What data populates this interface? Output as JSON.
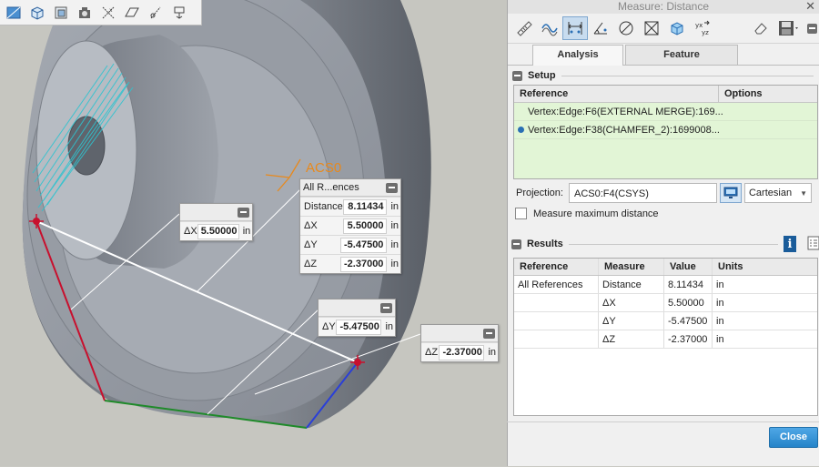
{
  "viewport": {
    "csys_label": "ACS0",
    "callout_main": {
      "title": "All R...ences",
      "rows": [
        {
          "label": "Distance",
          "value": "8.11434",
          "unit": "in"
        },
        {
          "label": "ΔX",
          "value": "5.50000",
          "unit": "in"
        },
        {
          "label": "ΔY",
          "value": "-5.47500",
          "unit": "in"
        },
        {
          "label": "ΔZ",
          "value": "-2.37000",
          "unit": "in"
        }
      ]
    },
    "callout_dx": {
      "label": "ΔX",
      "value": "5.50000",
      "unit": "in"
    },
    "callout_dy": {
      "label": "ΔY",
      "value": "-5.47500",
      "unit": "in"
    },
    "callout_dz": {
      "label": "ΔZ",
      "value": "-2.37000",
      "unit": "in"
    },
    "toolbar_icons": [
      "shade-icon",
      "view-cube-icon",
      "saved-views-icon",
      "camera-icon",
      "datum-display-icon",
      "plane-display-icon",
      "axis-display-icon",
      "spin-center-icon"
    ]
  },
  "panel": {
    "title": "Measure: Distance",
    "tabs": [
      "Analysis",
      "Feature"
    ],
    "setup": {
      "title": "Setup",
      "headers": [
        "Reference",
        "Options"
      ],
      "rows": [
        {
          "reference": "Vertex:Edge:F6(EXTERNAL MERGE):169...",
          "options": ""
        },
        {
          "reference": "Vertex:Edge:F38(CHAMFER_2):1699008...",
          "options": ""
        }
      ],
      "projection_label": "Projection:",
      "projection_value": "ACS0:F4(CSYS)",
      "coord_mode": "Cartesian",
      "max_distance_label": "Measure maximum distance"
    },
    "results": {
      "title": "Results",
      "headers": [
        "Reference",
        "Measure",
        "Value",
        "Units"
      ],
      "rows": [
        {
          "reference": "All References",
          "measure": "Distance",
          "value": "8.11434",
          "units": "in"
        },
        {
          "reference": "",
          "measure": "ΔX",
          "value": "5.50000",
          "units": "in"
        },
        {
          "reference": "",
          "measure": "ΔY",
          "value": "-5.47500",
          "units": "in"
        },
        {
          "reference": "",
          "measure": "ΔZ",
          "value": "-2.37000",
          "units": "in"
        }
      ]
    },
    "close_label": "Close"
  },
  "colors": {
    "accent": "#2584c9",
    "selection_green": "#e2f5d6",
    "csys_orange": "#e8891c",
    "highlight_teal": "#2fc3cf"
  }
}
